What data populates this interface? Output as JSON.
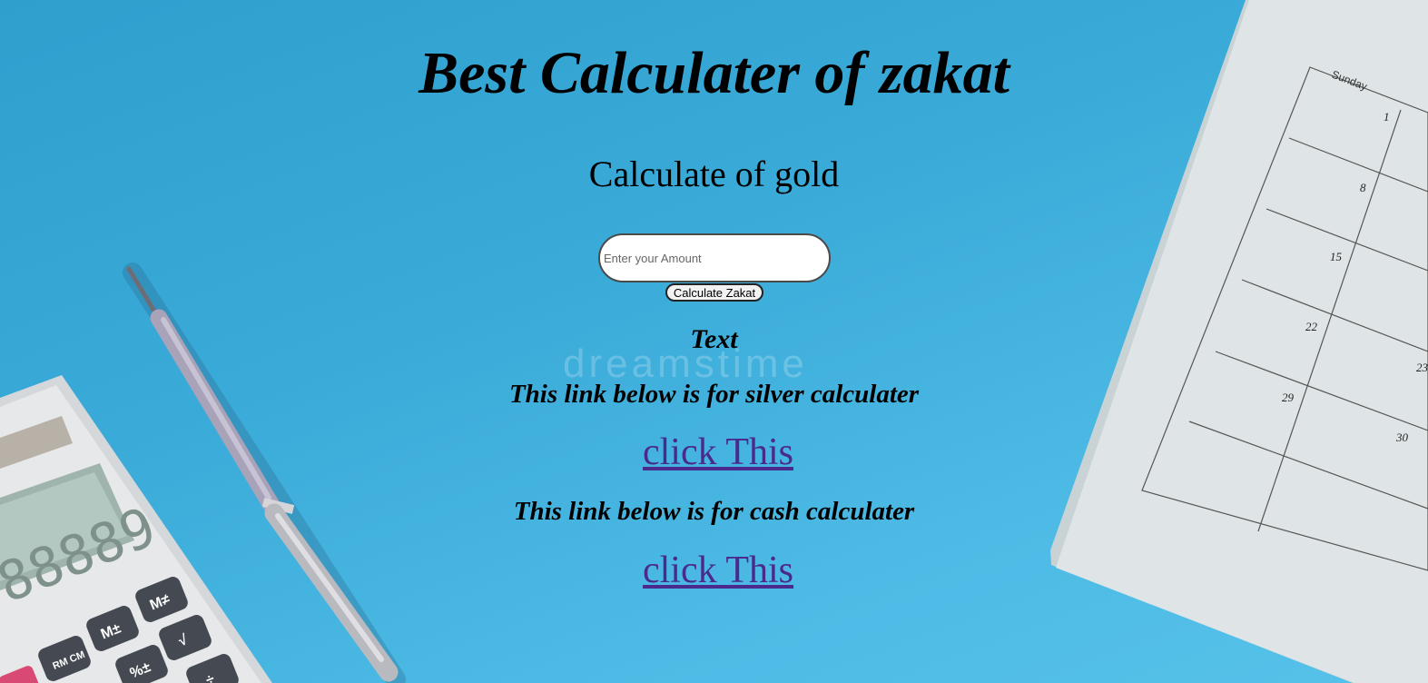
{
  "header": {
    "title": "Best Calculater of zakat"
  },
  "gold": {
    "heading": "Calculate of gold"
  },
  "amount_input": {
    "placeholder": "Enter your Amount",
    "value": ""
  },
  "calculate_button": {
    "label": "Calculate Zakat"
  },
  "result": {
    "text": "Text"
  },
  "silver": {
    "note": "This link below is for silver calculater",
    "link_label": "click This"
  },
  "cash": {
    "note": "This link below is for cash calculater",
    "link_label": "click This"
  },
  "watermark": {
    "text": "dreamstime"
  },
  "calendar": {
    "header": "Sunday",
    "dates": [
      "1",
      "8",
      "15",
      "22",
      "29",
      "30",
      "23"
    ]
  },
  "calculator": {
    "display": "88889",
    "keys": [
      "M≠",
      "M±",
      "RM\nCM",
      "√",
      "%±",
      "÷"
    ]
  },
  "colors": {
    "background": "#3aaad8",
    "link": "#4b2a8d",
    "text": "#000000"
  }
}
